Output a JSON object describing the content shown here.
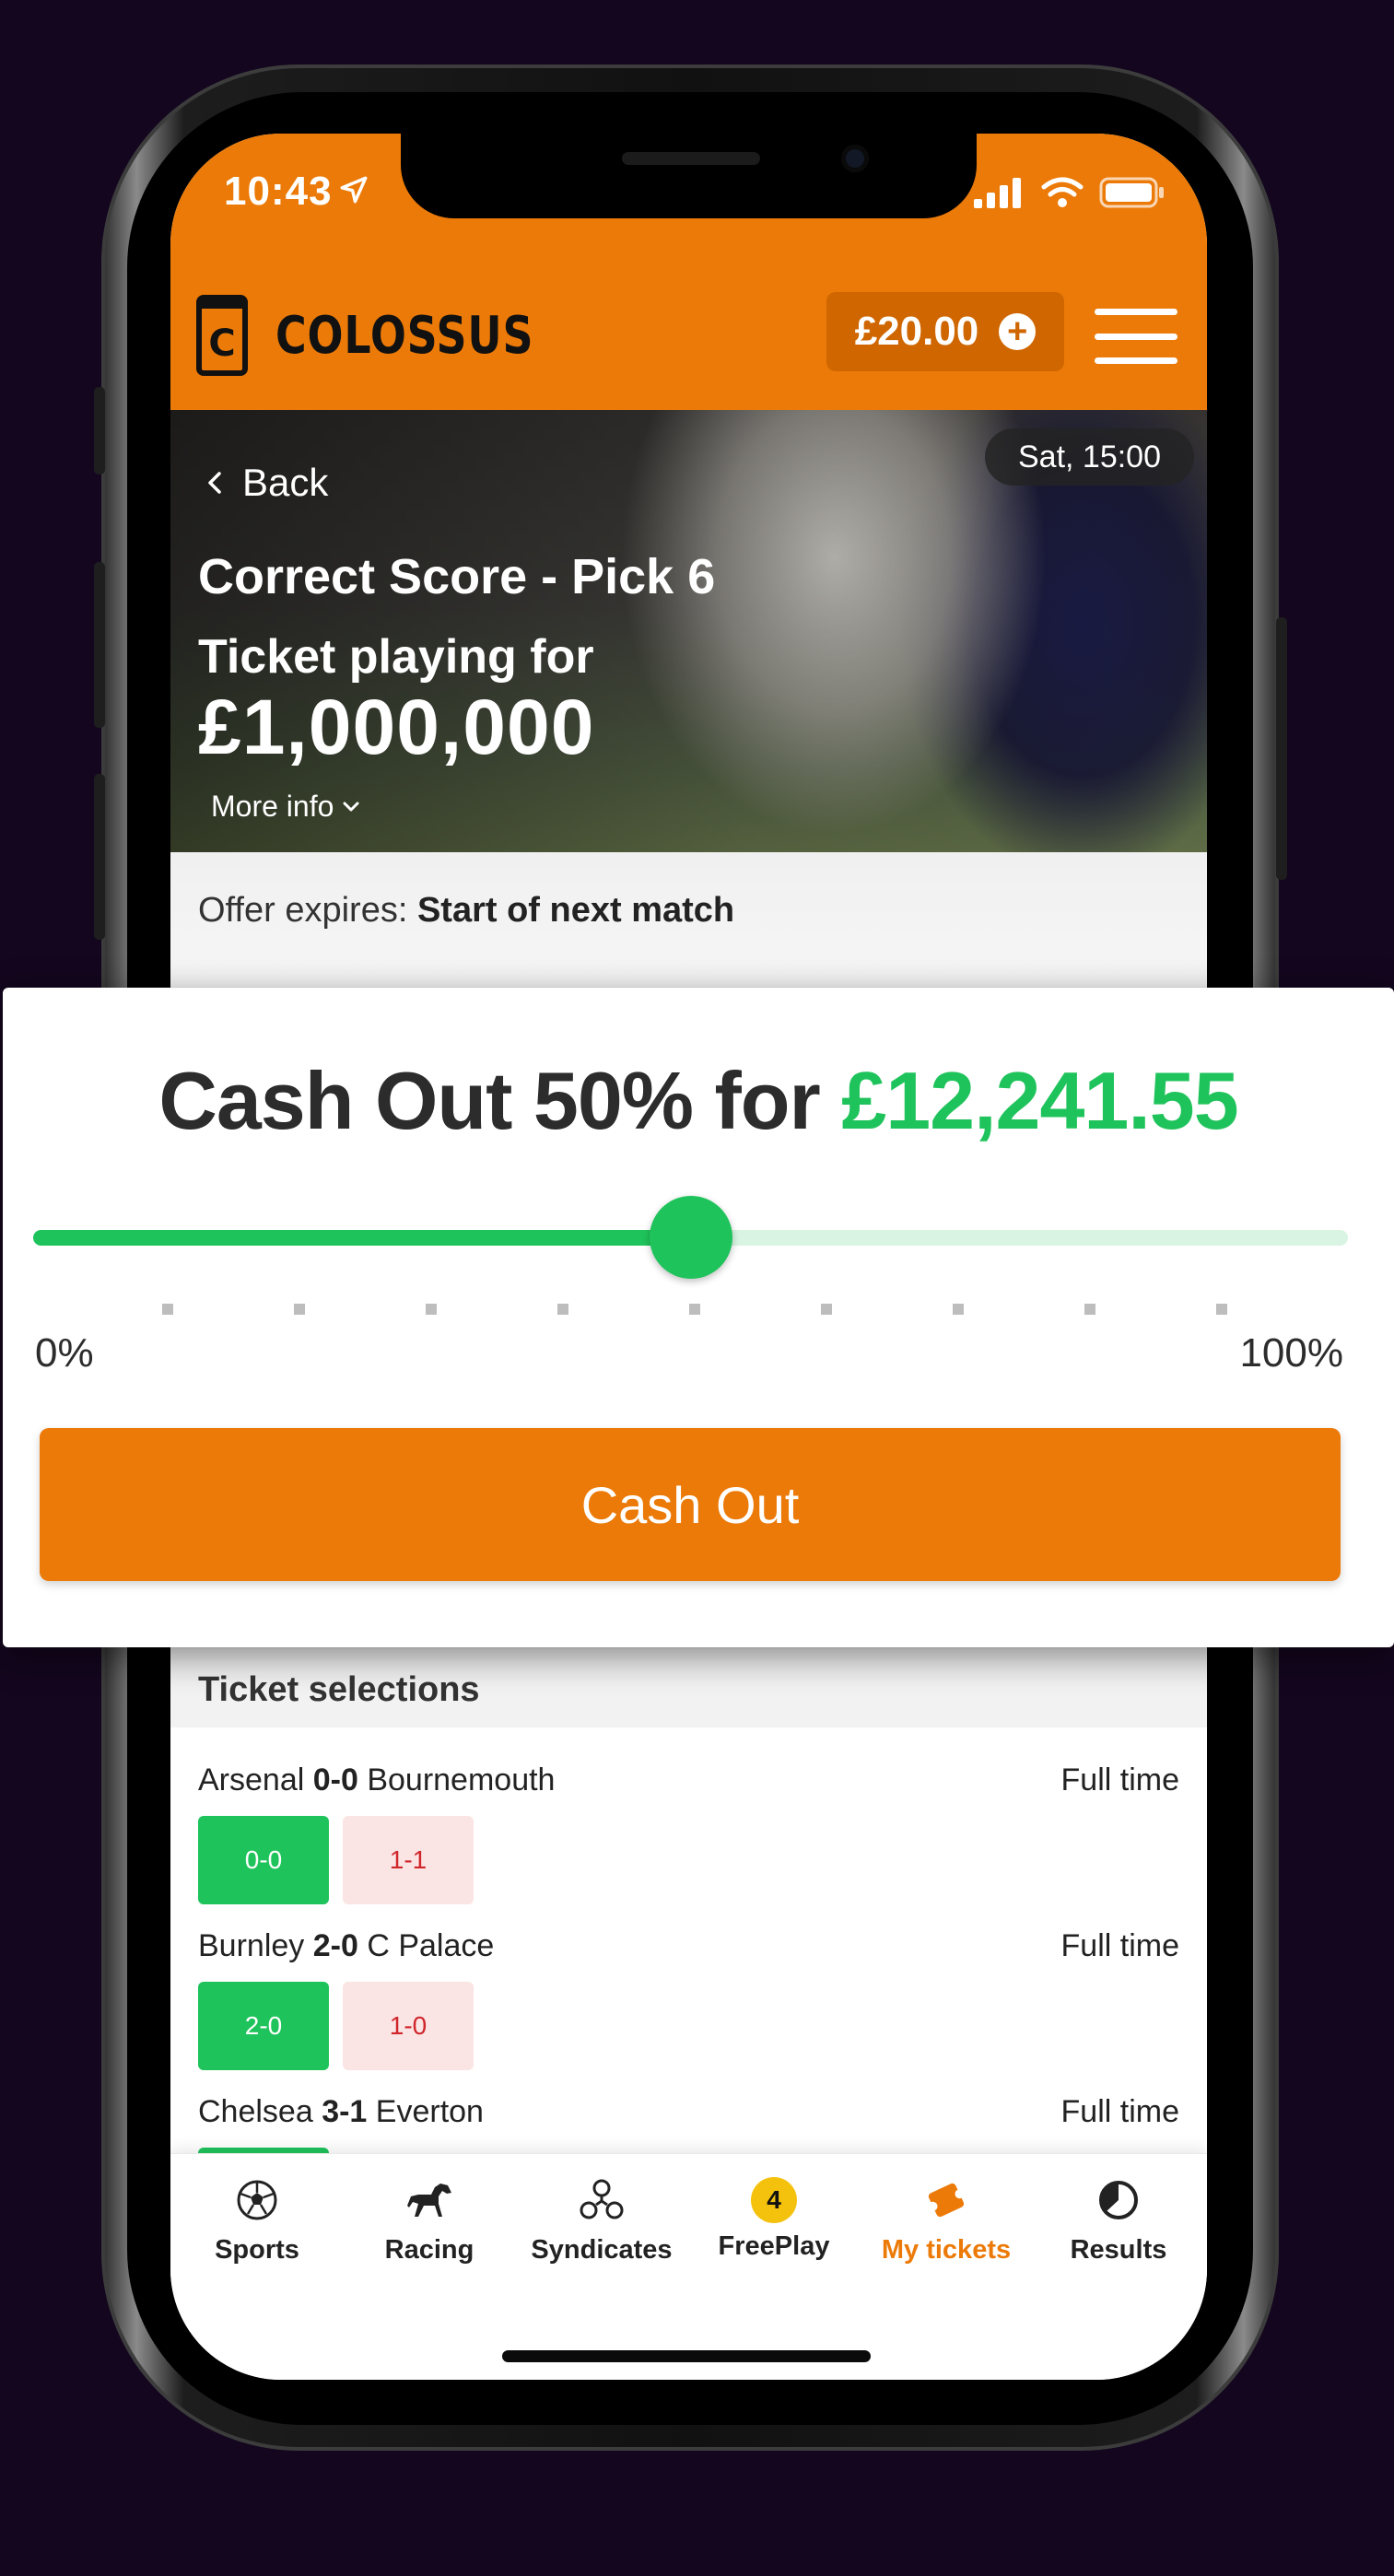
{
  "status_bar": {
    "time": "10:43"
  },
  "header": {
    "brand": "COLOSSUS",
    "logo_letter": "C",
    "balance": "£20.00"
  },
  "hero": {
    "back_label": "Back",
    "kickoff": "Sat, 15:00",
    "title": "Correct Score - Pick 6",
    "subtitle": "Ticket playing for",
    "jackpot": "£1,000,000",
    "more_info": "More info"
  },
  "offer": {
    "label": "Offer expires:",
    "value": "Start of next match"
  },
  "cashout": {
    "title_prefix": "Cash Out 50% for",
    "amount": "£12,241.55",
    "percent": 50,
    "min_label": "0%",
    "max_label": "100%",
    "button_label": "Cash Out"
  },
  "selections": {
    "title": "Ticket selections",
    "matches": [
      {
        "home": "Arsenal",
        "score": "0-0",
        "away": "Bournemouth",
        "status": "Full time",
        "pick_win": "0-0",
        "pick_lose": "1-1"
      },
      {
        "home": "Burnley",
        "score": "2-0",
        "away": "C Palace",
        "status": "Full time",
        "pick_win": "2-0",
        "pick_lose": "1-0"
      },
      {
        "home": "Chelsea",
        "score": "3-1",
        "away": "Everton",
        "status": "Full time"
      }
    ]
  },
  "tabs": [
    {
      "label": "Sports",
      "icon": "football-icon"
    },
    {
      "label": "Racing",
      "icon": "horse-icon"
    },
    {
      "label": "Syndicates",
      "icon": "syndicates-icon"
    },
    {
      "label": "FreePlay",
      "icon": "freeplay-badge",
      "badge": "4"
    },
    {
      "label": "My tickets",
      "icon": "ticket-icon",
      "active": true
    },
    {
      "label": "Results",
      "icon": "results-icon"
    }
  ],
  "colors": {
    "brand_orange": "#ec7a08",
    "win_green": "#1fc35b",
    "lose_red": "#d0252a"
  }
}
